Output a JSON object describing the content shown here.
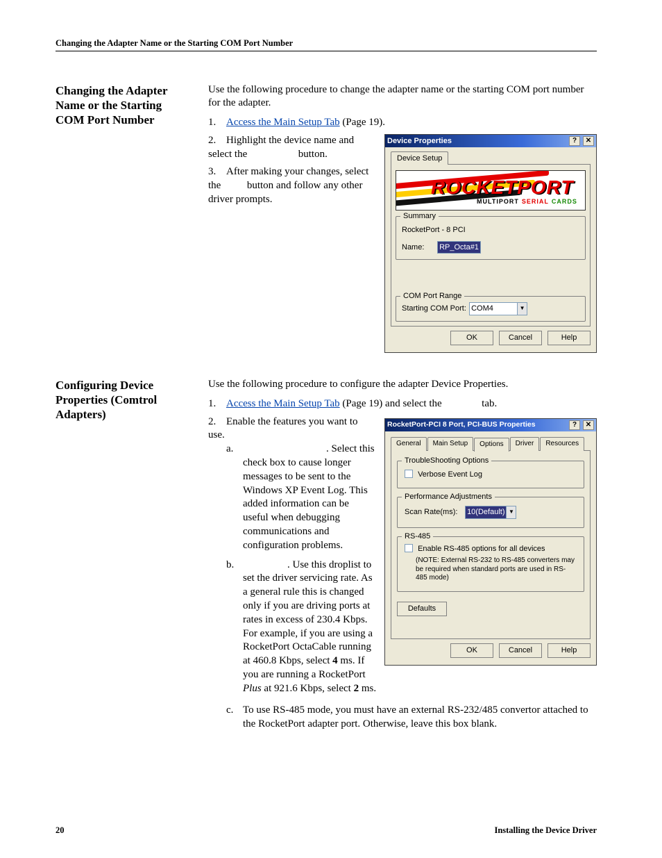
{
  "runningHead": "Changing the Adapter Name or the Starting COM Port Number",
  "pageNumber": "20",
  "footerTitle": "Installing the Device Driver",
  "sectionA": {
    "heading": "Changing the Adapter Name or the Starting COM Port Number",
    "intro": "Use the following procedure to change the adapter name or the starting COM port number for the adapter.",
    "steps": {
      "n1": "1.",
      "s1_link": "Access the Main Setup Tab",
      "s1_after": " (Page 19).",
      "n2": "2.",
      "s2a": "Highlight the device name and select the ",
      "s2b": " button.",
      "n3": "3.",
      "s3a": "After making your changes, select the ",
      "s3b": " button and follow any other driver prompts."
    }
  },
  "dialog1": {
    "title": "Device Properties",
    "help": "?",
    "close": "✕",
    "tab": "Device Setup",
    "banner_word": "ROCKETPORT",
    "banner_sub1": "MULTIPORT",
    "banner_sub2": "SERIAL",
    "banner_sub3": "CARDS",
    "summary_legend": "Summary",
    "summary_caption": "RocketPort - 8  PCI",
    "name_label": "Name:",
    "name_value": "RP_Octa#1",
    "range_legend": "COM Port Range",
    "range_label": "Starting COM Port:",
    "range_value": "COM4",
    "ok": "OK",
    "cancel": "Cancel",
    "helpbtn": "Help"
  },
  "sectionB": {
    "heading": "Configuring Device Properties (Comtrol Adapters)",
    "intro": "Use the following procedure to configure the adapter Device Properties.",
    "steps": {
      "n1": "1.",
      "s1_link": "Access the Main Setup Tab",
      "s1_after1": " (Page 19) and select the ",
      "s1_after2": " tab.",
      "n2": "2.",
      "s2": "Enable the features you want to use.",
      "a_mark": "a.",
      "a1": " ",
      "a2": ". Select this check box to cause longer messages to be sent to the Windows XP Event Log. This added information can be useful when debugging communications and configuration problems.",
      "b_mark": "b.",
      "b1": " ",
      "b2": ". Use this droplist to set the driver servicing rate. As a general rule this is changed only if you are driving ports at rates in excess of 230.4 Kbps. For example, if you are using a RocketPort OctaCable running at 460.8 Kbps, select ",
      "b_bold1": "4",
      "b3": " ms. If you are running a RocketPort ",
      "b_ital": "Plus",
      "b4": " at 921.6 Kbps, select ",
      "b_bold2": "2",
      "b5": " ms.",
      "c_mark": "c.",
      "c": "To use RS-485 mode, you must have an external RS-232/485 convertor attached to the RocketPort adapter port. Otherwise, leave this box blank."
    }
  },
  "dialog2": {
    "title": "RocketPort-PCI 8 Port, PCI-BUS Properties",
    "help": "?",
    "close": "✕",
    "tabs": {
      "t0": "General",
      "t1": "Main Setup",
      "t2": "Options",
      "t3": "Driver",
      "t4": "Resources"
    },
    "ts_legend": "TroubleShooting Options",
    "ts_chk": "Verbose Event Log",
    "pa_legend": "Performance Adjustments",
    "pa_label": "Scan Rate(ms):",
    "pa_value": "10(Default)",
    "rs_legend": "RS-485",
    "rs_chk": "Enable RS-485 options for all devices",
    "rs_note": "(NOTE: External RS-232 to RS-485 converters may be required when standard ports are used in RS-485 mode)",
    "defaults": "Defaults",
    "ok": "OK",
    "cancel": "Cancel",
    "helpbtn": "Help"
  }
}
